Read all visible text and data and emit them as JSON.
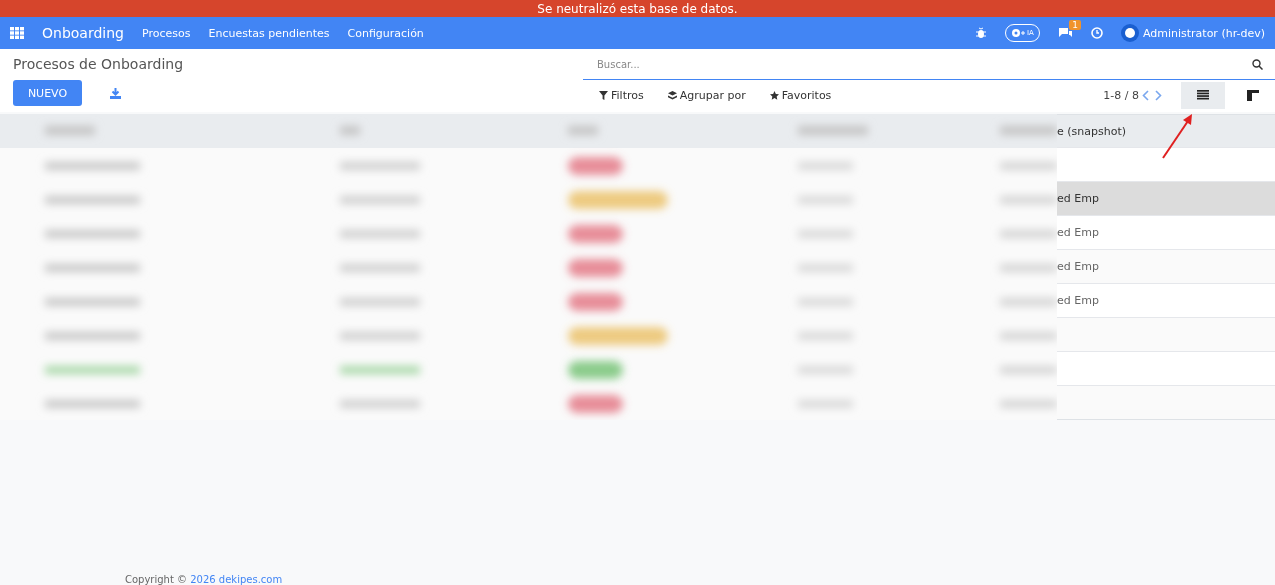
{
  "banner": {
    "text": "Se neutralizó esta base de datos."
  },
  "navbar": {
    "app_name": "Onboarding",
    "menus": [
      "Procesos",
      "Encuestas pendientes",
      "Configuración"
    ],
    "ai_label": "IA",
    "chat_count": "1",
    "user": "Administrator (hr-dev)"
  },
  "control_panel": {
    "title": "Procesos de Onboarding",
    "new_button": "NUEVO",
    "search": {
      "placeholder": "Buscar..."
    },
    "filters": [
      "Filtros",
      "Agrupar por",
      "Favoritos"
    ],
    "pager": "1-8 / 8",
    "views": [
      {
        "kind": "list",
        "selected": true
      },
      {
        "kind": "kanban",
        "selected": false
      }
    ]
  },
  "table": {
    "column_header": "e (snapshot)",
    "rows": [
      {
        "text": "",
        "hovered": false
      },
      {
        "text": "ed Emp",
        "hovered": true
      },
      {
        "text": "ed Emp",
        "hovered": false
      },
      {
        "text": "ed Emp",
        "hovered": false
      },
      {
        "text": "ed Emp",
        "hovered": false
      },
      {
        "text": "",
        "hovered": false
      },
      {
        "text": "",
        "hovered": false
      },
      {
        "text": "",
        "hovered": false
      }
    ]
  },
  "footer": {
    "text": "Copyright © ",
    "link": "2026 dekipes.com"
  }
}
